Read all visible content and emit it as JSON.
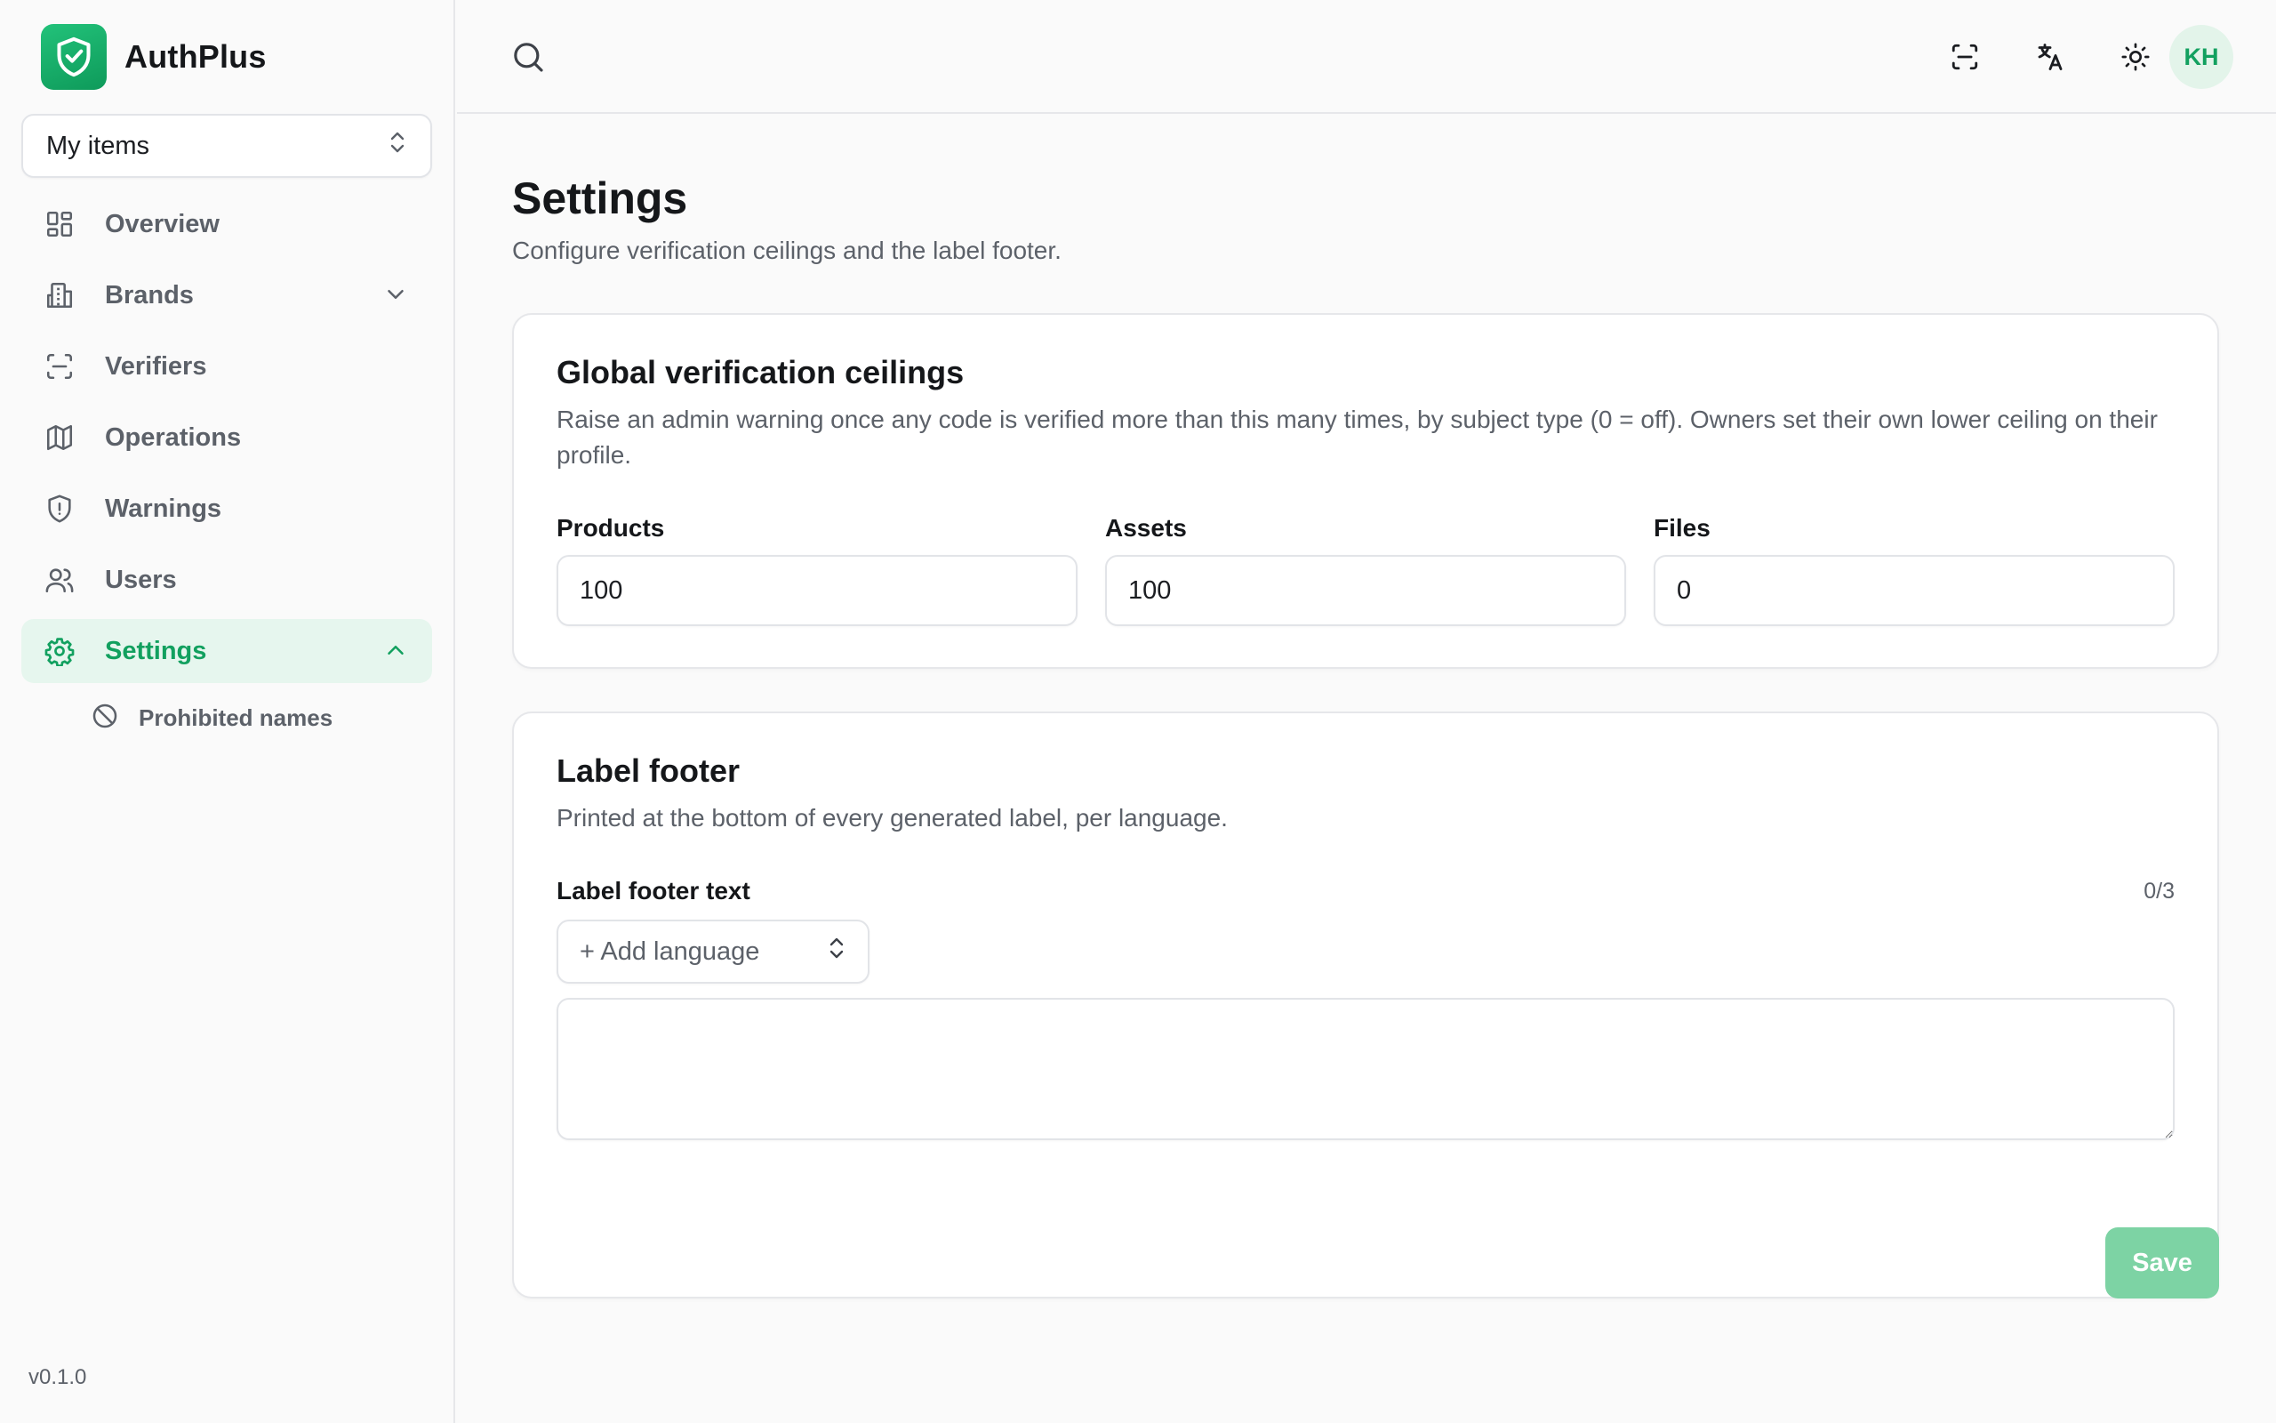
{
  "app": {
    "name": "AuthPlus",
    "version": "v0.1.0"
  },
  "workspace": {
    "selected": "My items"
  },
  "sidebar": {
    "items": [
      {
        "label": "Overview",
        "icon": "grid-icon"
      },
      {
        "label": "Brands",
        "icon": "building-icon",
        "expandable": true,
        "expanded": false
      },
      {
        "label": "Verifiers",
        "icon": "scan-icon"
      },
      {
        "label": "Operations",
        "icon": "map-icon"
      },
      {
        "label": "Warnings",
        "icon": "shield-alert-icon"
      },
      {
        "label": "Users",
        "icon": "users-icon"
      },
      {
        "label": "Settings",
        "icon": "gear-icon",
        "expandable": true,
        "expanded": true,
        "active": true
      }
    ],
    "sub_items": [
      {
        "label": "Prohibited names",
        "icon": "ban-icon"
      }
    ]
  },
  "topbar": {
    "avatar_initials": "KH",
    "icons": [
      "search-icon",
      "scan-icon",
      "translate-icon",
      "sun-icon"
    ]
  },
  "page": {
    "title": "Settings",
    "subtitle": "Configure verification ceilings and the label footer."
  },
  "ceilings": {
    "title": "Global verification ceilings",
    "description": "Raise an admin warning once any code is verified more than this many times, by subject type (0 = off). Owners set their own lower ceiling on their profile.",
    "fields": [
      {
        "label": "Products",
        "value": "100"
      },
      {
        "label": "Assets",
        "value": "100"
      },
      {
        "label": "Files",
        "value": "0"
      }
    ]
  },
  "label_footer": {
    "title": "Label footer",
    "description": "Printed at the bottom of every generated label, per language.",
    "field_label": "Label footer text",
    "counter": "0/3",
    "add_language_label": "+ Add language",
    "text_value": ""
  },
  "actions": {
    "save_label": "Save"
  },
  "colors": {
    "accent": "#12a05f",
    "accent_soft": "#e6f6ee",
    "save_disabled": "#7dd3a4"
  }
}
